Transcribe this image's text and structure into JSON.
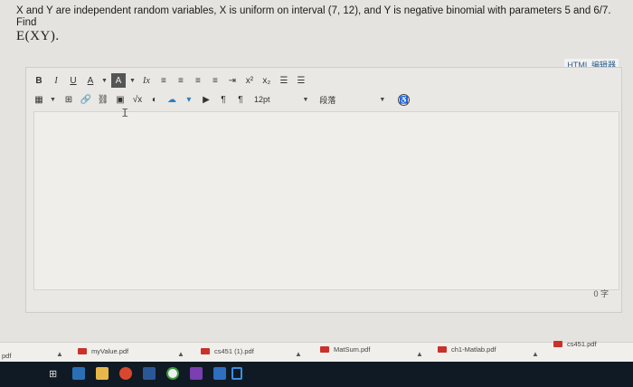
{
  "question": {
    "text": "X and Y are independent random variables, X is uniform on interval (7, 12), and Y is negative binomial with parameters 5 and 6/7. Find",
    "expression": "E(XY)."
  },
  "editor": {
    "html_toggle": "HTML 编辑器",
    "toolbar_row1": {
      "bold": "B",
      "italic": "I",
      "underline": "U",
      "font_color": "A",
      "bg_color": "A",
      "clear_format": "Ix",
      "align_left": "≡",
      "align_center": "≡",
      "align_right": "≡",
      "justify": "≡",
      "indent": "⇥",
      "superscript": "x²",
      "subscript": "x₂",
      "bullet_list": "☰",
      "numbered_list": "☰"
    },
    "toolbar_row2": {
      "table": "▦",
      "embed": "⊞",
      "link": "🔗",
      "unlink": "⛓",
      "image": "▣",
      "formula": "√x",
      "media": "◐",
      "cloud": "☁",
      "chevron": "▾",
      "video": "▶",
      "ltr": "¶",
      "rtl": "¶",
      "font_size": "12pt",
      "paragraph": "段落",
      "accessibility": "♿"
    },
    "word_count": "0 字"
  },
  "downloads": {
    "left_label": "pdf",
    "items": [
      "myValue.pdf",
      "cs451 (1).pdf",
      "MatSum.pdf",
      "ch1-Matlab.pdf",
      "cs451.pdf"
    ]
  },
  "colors": {
    "background": "#e4e3df",
    "taskbar": "#101a24",
    "pdf_badge": "#c9312a"
  }
}
